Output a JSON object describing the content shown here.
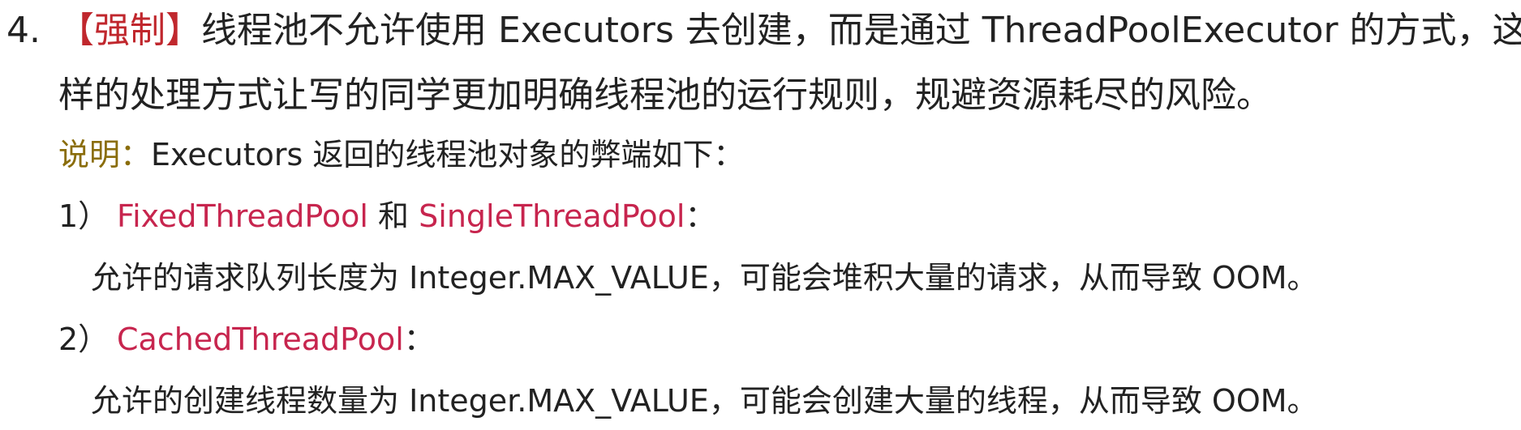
{
  "rule": {
    "number": "4.",
    "tag": "【强制】",
    "text_line1": "线程池不允许使用 Executors 去创建，而是通过 ThreadPoolExecutor 的方式，这",
    "text_line2": "样的处理方式让写的同学更加明确线程池的运行规则，规避资源耗尽的风险。"
  },
  "note": {
    "label": "说明：",
    "text": "Executors 返回的线程池对象的弊端如下："
  },
  "items": [
    {
      "index": "1）",
      "pool_a": "FixedThreadPool",
      "joiner": " 和 ",
      "pool_b": "SingleThreadPool",
      "colon": "：",
      "detail": "允许的请求队列长度为 Integer.MAX_VALUE，可能会堆积大量的请求，从而导致 OOM。"
    },
    {
      "index": "2）",
      "pool_a": "CachedThreadPool",
      "colon": "：",
      "detail": "允许的创建线程数量为 Integer.MAX_VALUE，可能会创建大量的线程，从而导致 OOM。"
    }
  ],
  "colors": {
    "tag": "#c0272d",
    "note_label": "#8a6d0b",
    "pool_name": "#c7254e",
    "body_text": "#222222"
  }
}
